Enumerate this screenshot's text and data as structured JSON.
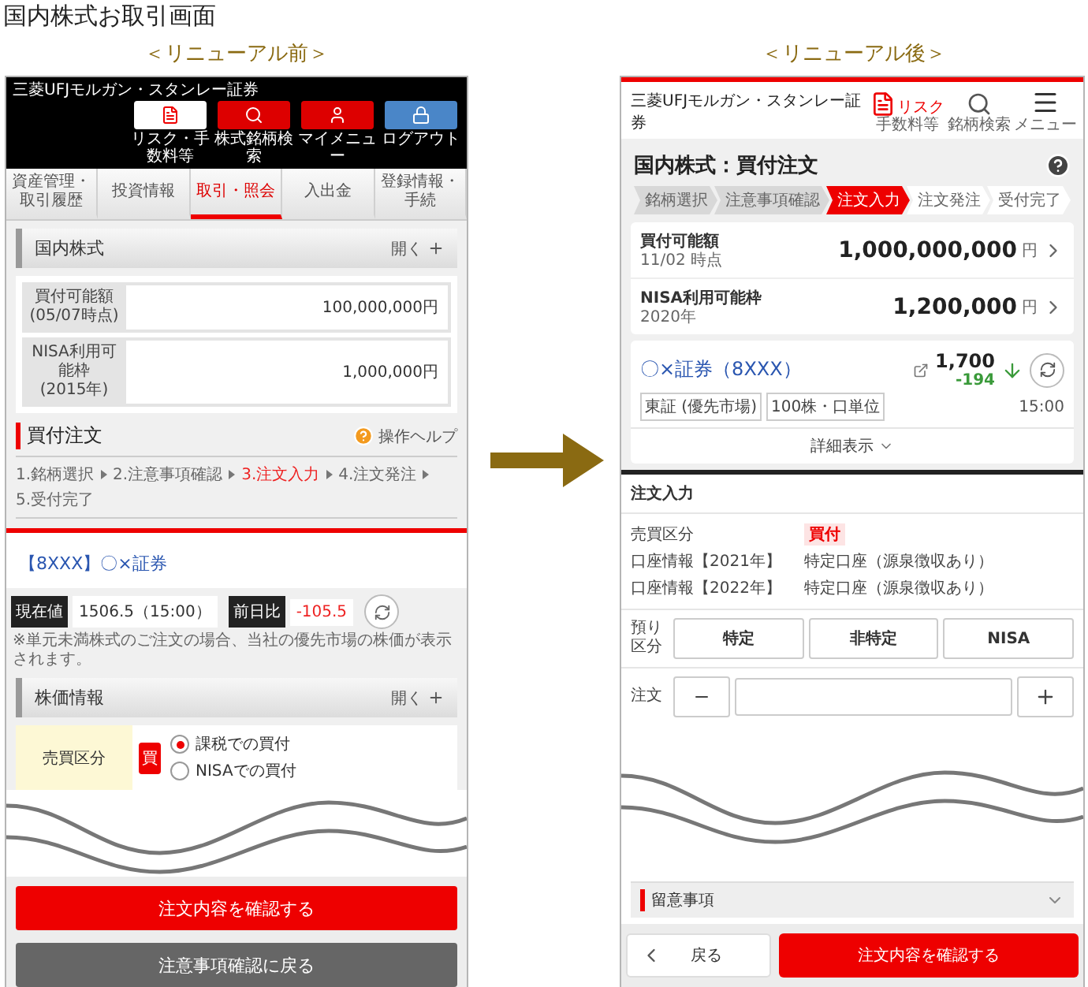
{
  "title": "国内株式お取引画面",
  "before": {
    "label": "＜リニューアル前＞",
    "brand": "三菱UFJモルガン・スタンレー証券",
    "header_buttons": [
      {
        "kind": "risk",
        "label": "リスク・手数料等"
      },
      {
        "kind": "search",
        "label": "株式銘柄検索"
      },
      {
        "kind": "user",
        "label": "マイメニュー"
      },
      {
        "kind": "lock",
        "label": "ログアウト"
      }
    ],
    "nav_tabs": [
      {
        "label": "資産管理・取引履歴",
        "selected": false
      },
      {
        "label": "投資情報",
        "selected": false
      },
      {
        "label": "取引・照会",
        "selected": true
      },
      {
        "label": "入出金",
        "selected": false
      },
      {
        "label": "登録情報・手続",
        "selected": false
      }
    ],
    "section": {
      "title": "国内株式",
      "toggle": "開く"
    },
    "balances": [
      {
        "label": "買付可能額",
        "sub": "(05/07時点)",
        "value": "100,000,000円"
      },
      {
        "label": "NISA利用可能枠",
        "sub": "(2015年)",
        "value": "1,000,000円"
      }
    ],
    "order_title": "買付注文",
    "help": "操作ヘルプ",
    "steps": [
      {
        "label": "1.銘柄選択",
        "selected": false
      },
      {
        "label": "2.注意事項確認",
        "selected": false
      },
      {
        "label": "3.注文入力",
        "selected": true
      },
      {
        "label": "4.注文発注",
        "selected": false
      },
      {
        "label": "5.受付完了",
        "selected": false
      }
    ],
    "stock": "【8XXX】〇×証券",
    "price_label": "現在値",
    "price": "1506.5（15:00）",
    "change_label": "前日比",
    "change": "-105.5",
    "note": "※単元未満株式のご注文の場合、当社の優先市場の株価が表示されます。",
    "price_info": {
      "title": "株価情報",
      "toggle": "開く"
    },
    "trade_type": {
      "label": "売買区分",
      "badge": "買",
      "options": [
        {
          "label": "課税での買付",
          "selected": true
        },
        {
          "label": "NISAでの買付",
          "selected": false
        }
      ]
    },
    "buttons": [
      {
        "kind": "primary",
        "label": "注文内容を確認する"
      },
      {
        "kind": "secondary",
        "label": "注意事項確認に戻る"
      }
    ]
  },
  "after": {
    "label": "＜リニューアル後＞",
    "brand": "三菱UFJモルガン・スタンレー証券",
    "header_buttons": [
      {
        "kind": "risk",
        "side": "リスク",
        "label": "手数料等"
      },
      {
        "kind": "search",
        "label": "銘柄検索"
      },
      {
        "kind": "menu",
        "label": "メニュー"
      }
    ],
    "page_title": "国内株式：買付注文",
    "steps": [
      {
        "label": "銘柄選択",
        "selected": false,
        "done": true
      },
      {
        "label": "注意事項確認",
        "selected": false,
        "done": true
      },
      {
        "label": "注文入力",
        "selected": true,
        "done": false
      },
      {
        "label": "注文発注",
        "selected": false,
        "done": false
      },
      {
        "label": "受付完了",
        "selected": false,
        "done": false
      }
    ],
    "balances": [
      {
        "label": "買付可能額",
        "sub": "11/02 時点",
        "value": "1,000,000,000",
        "unit": "円"
      },
      {
        "label": "NISA利用可能枠",
        "sub": "2020年",
        "value": "1,200,000",
        "unit": "円"
      }
    ],
    "stock": {
      "name": "〇×証券（8XXX）",
      "price": "1,700",
      "change": "-194",
      "tags": [
        "東証 (優先市場)",
        "100株・口単位"
      ],
      "time": "15:00",
      "details": "詳細表示"
    },
    "order_section": "注文入力",
    "info_rows": [
      {
        "kind": "badge",
        "label": "売買区分",
        "value": "買付"
      },
      {
        "kind": "text",
        "label": "口座情報【2021年】",
        "value": "特定口座（源泉徴収あり）"
      },
      {
        "kind": "text",
        "label": "口座情報【2022年】",
        "value": "特定口座（源泉徴収あり）"
      }
    ],
    "deposit": {
      "label": "預り区分",
      "options": [
        "特定",
        "非特定",
        "NISA"
      ]
    },
    "quantity": {
      "label": "注文"
    },
    "notes_title": "留意事項",
    "buttons": [
      {
        "kind": "back",
        "label": "戻る"
      },
      {
        "kind": "primary",
        "label": "注文内容を確認する"
      }
    ]
  }
}
